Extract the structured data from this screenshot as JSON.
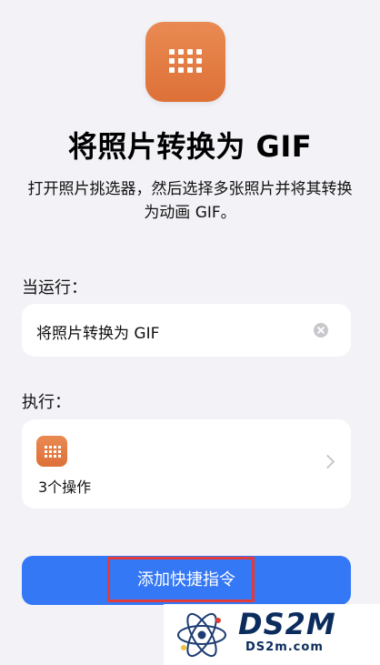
{
  "shortcut": {
    "title": "将照片转换为 GIF",
    "description": "打开照片挑选器，然后选择多张照片并将其转换为动画 GIF。",
    "icon": "grid-icon",
    "accent_color": "#e27b43"
  },
  "run_section": {
    "label": "当运行：",
    "name_value": "将照片转换为 GIF"
  },
  "execute_section": {
    "label": "执行：",
    "action_count": "3个操作"
  },
  "add_button": {
    "label": "添加快捷指令",
    "color": "#3478f6"
  },
  "watermark": {
    "brand": "DS2M",
    "domain": "DS2m.com"
  }
}
